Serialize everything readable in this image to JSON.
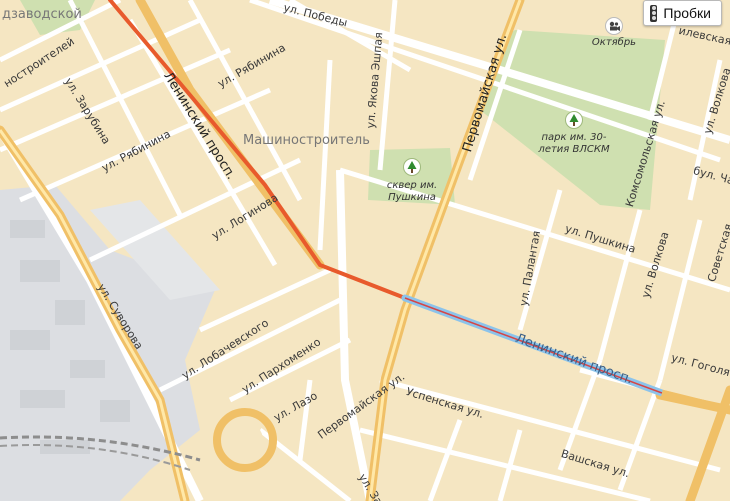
{
  "toolbar": {
    "traffic_label": "Пробки"
  },
  "colors": {
    "background": "#f5e6c2",
    "park": "#cfe0b0",
    "industrial": "#dfe1e3",
    "major_road": "#f0c067",
    "route_red": "#e85a2c",
    "route_blue": "#8cc3ea"
  },
  "labels": {
    "district": "Машиностроитель",
    "district_corner": "дзаводской",
    "leninsky_1": "Ленинский просп.",
    "leninsky_2": "Ленинский просп.",
    "pervomayskaya_1": "Первомайская ул.",
    "pervomayskaya_2": "Первомайская ул.",
    "pobedy": "ул. Победы",
    "ryabinina_1": "ул. Рябинина",
    "ryabinina_2": "ул. Рябинина",
    "zarubina": "ул. Зарубина",
    "stroitelei": "ностроителей",
    "yakova_eshpaya": "ул. Якова Эшпая",
    "loginova": "ул. Логинова",
    "suvorova": "ул. Суворова",
    "lobachevskogo": "ул. Лобачевского",
    "parkhomenko": "ул. Пархоменко",
    "lazo": "ул. Лазо",
    "pushkina": "ул. Пушкина",
    "palantaya": "ул. Палантая",
    "volkova_1": "ул. Волкова",
    "volkova_2": "ул. Волкова",
    "komsomolskaya": "Комсомольская ул.",
    "sovetskaya": "Советская",
    "gogolya": "ул. Гоголя",
    "uspenskaya": "Успенская ул.",
    "vashskaya": "Вашская ул.",
    "chapaeva": "бул. Ча",
    "lesnaya": "илевская ул.",
    "zav": "ул. Зав"
  },
  "pois": {
    "pushkin_square": "сквер им. Пушкина",
    "park_30": "парк им. 30-летия ВЛСКМ",
    "oktyabr": "Октябрь"
  }
}
